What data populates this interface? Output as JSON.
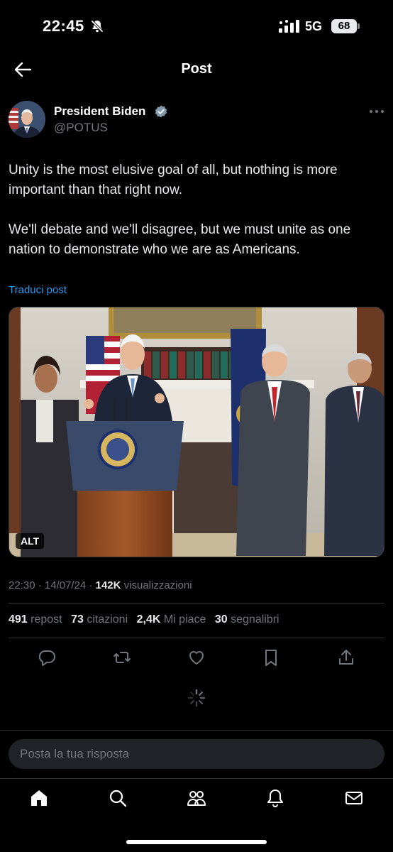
{
  "status_bar": {
    "time": "22:45",
    "network": "5G",
    "battery": "68"
  },
  "header": {
    "title": "Post"
  },
  "author": {
    "name": "President Biden",
    "handle": "@POTUS"
  },
  "post": {
    "paragraph_1": "Unity is the most elusive goal of all, but nothing is more important than that right now.",
    "paragraph_2": "We'll debate and we'll disagree, but we must unite as one nation to demonstrate who we are as Americans.",
    "translate_label": "Traduci post",
    "alt_label": "ALT"
  },
  "meta": {
    "time": "22:30",
    "separator": " · ",
    "date": "14/07/24",
    "views_count": "142K",
    "views_label": "visualizzazioni"
  },
  "stats": [
    {
      "count": "491",
      "label": "repost"
    },
    {
      "count": "73",
      "label": "citazioni"
    },
    {
      "count": "2,4K",
      "label": "Mi piace"
    },
    {
      "count": "30",
      "label": "segnalibri"
    }
  ],
  "actions": [
    "reply-icon",
    "repost-icon",
    "like-icon",
    "bookmark-icon",
    "share-icon"
  ],
  "reply": {
    "placeholder": "Posta la tua risposta"
  },
  "nav": [
    "home-icon",
    "search-icon",
    "communities-icon",
    "notifications-icon",
    "messages-icon"
  ],
  "colors": {
    "background": "#000000",
    "text": "#e7e9ea",
    "secondary": "#71767b",
    "link": "#1d9bf0",
    "divider": "#2f3336"
  }
}
